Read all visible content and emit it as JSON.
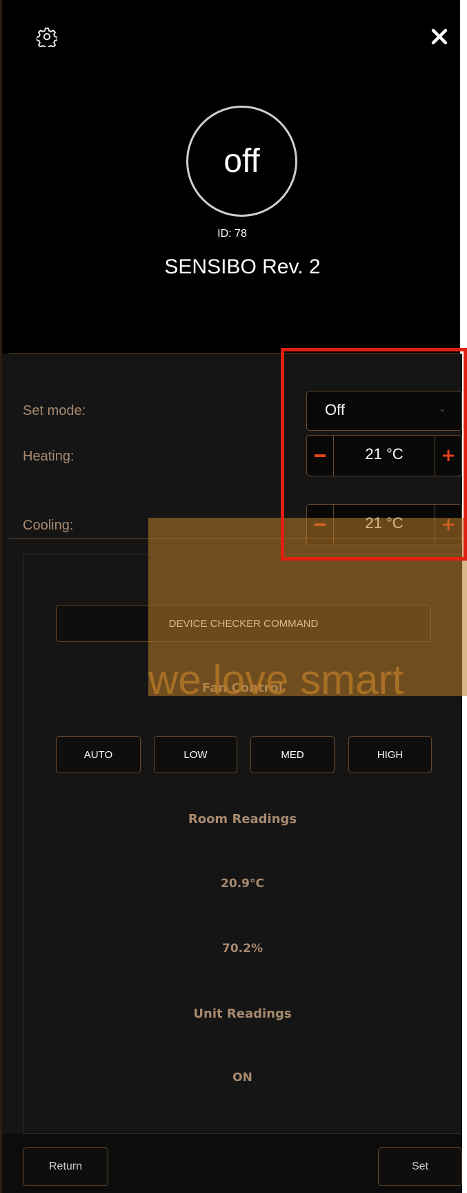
{
  "header": {
    "settings_icon": "gear-icon",
    "close_icon": "close-icon"
  },
  "device": {
    "power_state": "off",
    "id_text": "ID: 78",
    "name": "SENSIBO Rev. 2"
  },
  "controls": {
    "mode_label": "Set mode:",
    "mode_value": "Off",
    "heating_label": "Heating:",
    "heating_value": "21 °C",
    "cooling_label": "Cooling:",
    "cooling_value": "21 °C"
  },
  "watermark": {
    "text": "we love smart",
    "color": "#ba7c28"
  },
  "checker": {
    "command_label": "DEVICE CHECKER COMMAND"
  },
  "fan": {
    "title": "Fan Control",
    "buttons": [
      "AUTO",
      "LOW",
      "MED",
      "HIGH"
    ]
  },
  "room": {
    "title": "Room Readings",
    "temperature": "20.9°C",
    "humidity": "70.2%"
  },
  "unit": {
    "title": "Unit Readings",
    "state": "ON"
  },
  "footer": {
    "return_label": "Return",
    "set_label": "Set"
  },
  "colors": {
    "accent": "#e0431a",
    "border": "#6a4a2e",
    "highlight": "#e02010",
    "label": "#a88a6f"
  }
}
